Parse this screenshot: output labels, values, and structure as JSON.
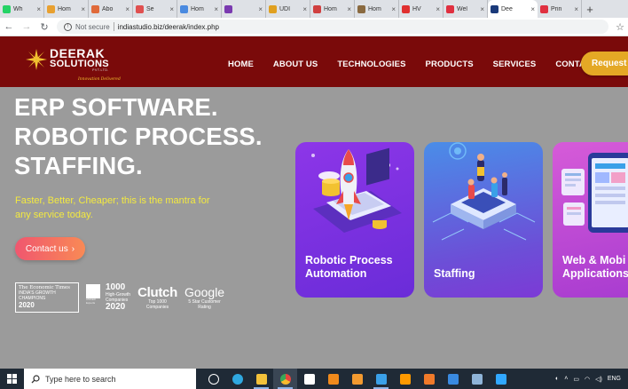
{
  "browser": {
    "tabs": [
      {
        "label": "Wh",
        "color": "#25d366"
      },
      {
        "label": "Hom",
        "color": "#e8a030"
      },
      {
        "label": "Abo",
        "color": "#e06a3a"
      },
      {
        "label": "Se",
        "color": "#e05050"
      },
      {
        "label": "Hom",
        "color": "#4a8ae0"
      },
      {
        "label": "",
        "color": "#7a3ab0"
      },
      {
        "label": "UDI",
        "color": "#e0a020"
      },
      {
        "label": "Hom",
        "color": "#d04040"
      },
      {
        "label": "Hom",
        "color": "#8a6a40"
      },
      {
        "label": "HV",
        "color": "#e03030"
      },
      {
        "label": "Wel",
        "color": "#e03040"
      },
      {
        "label": "Dee",
        "color": "#1a3a7a"
      },
      {
        "label": "Prin",
        "color": "#e03040"
      }
    ],
    "active_tab_index": 11,
    "new_tab_label": "+",
    "security_label": "Not secure",
    "url": "indiastudio.biz/deerak/index.php"
  },
  "site": {
    "logo": {
      "line1": "DEERAK",
      "line2": "SOLUTIONS",
      "line3": "PVT.LTD.",
      "tagline": "Innovation Delivered"
    },
    "nav": [
      "HOME",
      "ABOUT US",
      "TECHNOLOGIES",
      "PRODUCTS",
      "SERVICES",
      "CONTACT US"
    ],
    "request_label": "Request A",
    "colors": {
      "header": "#7a0a0a",
      "accent": "#e4a825",
      "subtext": "#f4ea3f"
    }
  },
  "hero": {
    "headline": [
      "ERP SOFTWARE.",
      "ROBOTIC PROCESS.",
      "STAFFING."
    ],
    "subtext": "Faster, Better, Cheaper; this is the mantra for any service today.",
    "contact_label": "Contact us",
    "awards": {
      "et": {
        "line1": "The Economic Times",
        "line2": "INDIA'S GROWTH",
        "line3": "CHAMPIONS",
        "year": "2020"
      },
      "k1000": {
        "badge": "AMCER Experts",
        "big": "1000",
        "line1": "High-Growth",
        "line2": "Companies",
        "year": "2020"
      },
      "clutch": {
        "big": "Clutch",
        "line1": "Top 1000",
        "line2": "Companies"
      },
      "google": {
        "big": "Google",
        "line1": "5 Star Customer",
        "line2": "Rating"
      }
    },
    "cards": [
      {
        "line1": "Robotic Process",
        "line2": "Automation"
      },
      {
        "line1": "Staffing",
        "line2": ""
      },
      {
        "line1": "Web & Mobi",
        "line2": "Applications"
      }
    ]
  },
  "taskbar": {
    "search_placeholder": "Type here to search",
    "apps": [
      {
        "name": "task-view",
        "color": "#ffffff"
      },
      {
        "name": "edge",
        "color": "#2fa8e0"
      },
      {
        "name": "explorer",
        "color": "#f3c13a"
      },
      {
        "name": "chrome",
        "color": "#e8453c"
      },
      {
        "name": "store",
        "color": "#ffffff"
      },
      {
        "name": "vlc",
        "color": "#f08a1c"
      },
      {
        "name": "sublime",
        "color": "#f29a30"
      },
      {
        "name": "vscode",
        "color": "#3aa0e8"
      },
      {
        "name": "illustrator",
        "color": "#ff9a00"
      },
      {
        "name": "app-orange",
        "color": "#f07a2a"
      },
      {
        "name": "app-blue",
        "color": "#3a8ae0"
      },
      {
        "name": "app-folder",
        "color": "#8fb4d8"
      },
      {
        "name": "photoshop",
        "color": "#31a8ff"
      }
    ],
    "lang": "ENG"
  }
}
